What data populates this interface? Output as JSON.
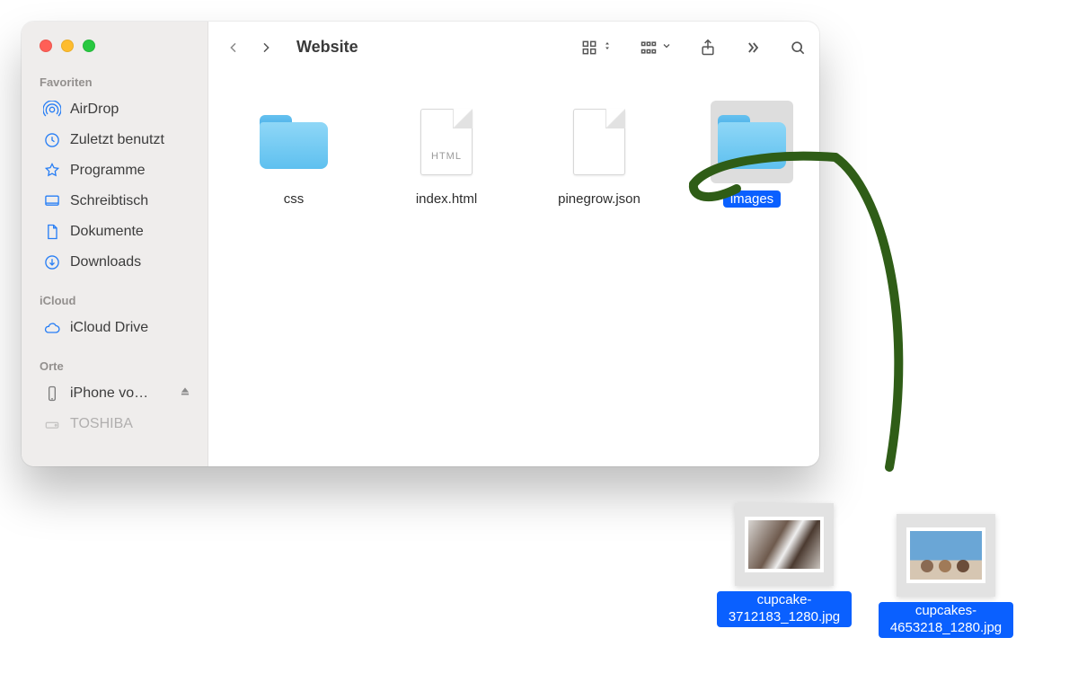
{
  "window": {
    "title": "Website"
  },
  "sidebar": {
    "groups": {
      "favorites": "Favoriten",
      "icloud": "iCloud",
      "locations": "Orte"
    },
    "favorites": [
      {
        "label": "AirDrop"
      },
      {
        "label": "Zuletzt benutzt"
      },
      {
        "label": "Programme"
      },
      {
        "label": "Schreibtisch"
      },
      {
        "label": "Dokumente"
      },
      {
        "label": "Downloads"
      }
    ],
    "icloud": [
      {
        "label": "iCloud Drive"
      }
    ],
    "locations": [
      {
        "label": "iPhone vo…"
      },
      {
        "label": "TOSHIBA"
      }
    ]
  },
  "files": [
    {
      "name": "css",
      "type": "folder",
      "selected": false
    },
    {
      "name": "index.html",
      "type": "html",
      "selected": false,
      "badge": "HTML"
    },
    {
      "name": "pinegrow.json",
      "type": "doc",
      "selected": false
    },
    {
      "name": "images",
      "type": "folder",
      "selected": true
    }
  ],
  "desktop_files": [
    {
      "name": "cupcake-3712183_1280.jpg"
    },
    {
      "name": "cupcakes-4653218_1280.jpg"
    }
  ],
  "colors": {
    "sidebar_icon": "#277ef5",
    "selection": "#0a60ff",
    "arrow": "#2f5d17"
  }
}
